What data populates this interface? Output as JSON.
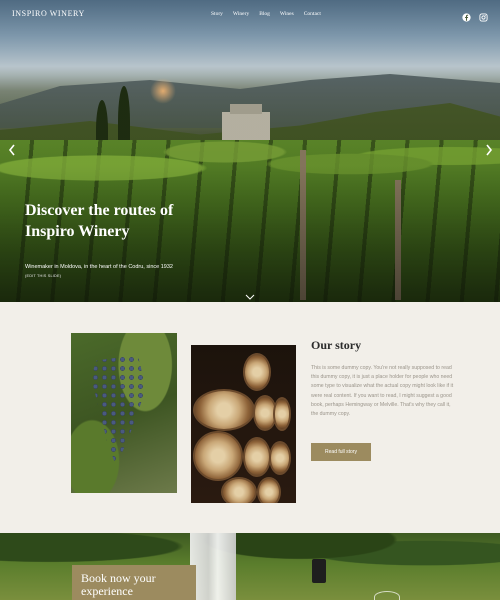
{
  "brand": {
    "logo": "INSPIRO WINERY"
  },
  "nav": {
    "items": [
      "Story",
      "Winery",
      "Blog",
      "Wines",
      "Contact"
    ]
  },
  "social": [
    "facebook-icon",
    "instagram-icon"
  ],
  "hero": {
    "title": "Discover the routes of Inspiro Winery",
    "subtitle": "Winemaker in Moldova, in the heart of the Codru, since 1932",
    "edit_link": "(EDIT THIS SLIDE)"
  },
  "story": {
    "title": "Our story",
    "text": "This is some dummy copy. You're not really supposed to read this dummy copy, it is just a place holder for people who need some type to visualize what the actual copy might look like if it were real content. If you want to read, I might suggest a good book, perhaps Hemingway or Melville. That's why they call it, the dummy copy.",
    "button": "Read full story"
  },
  "booking": {
    "title": "Book now your experience"
  },
  "colors": {
    "accent": "#9c8b5f",
    "background": "#f2efe9",
    "text": "#2b2b2b"
  }
}
